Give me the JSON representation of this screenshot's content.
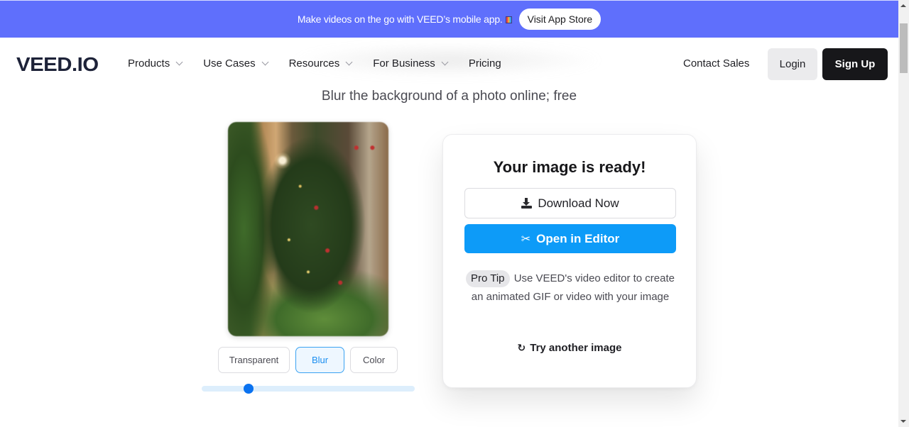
{
  "promo": {
    "text": "Make videos on the go with VEED’s mobile app.",
    "icon": "phone-app-icon",
    "cta_label": "Visit App Store",
    "bg_color": "#5f6ffc"
  },
  "nav": {
    "logo": "VEED.IO",
    "items": [
      {
        "label": "Products",
        "has_dropdown": true
      },
      {
        "label": "Use Cases",
        "has_dropdown": true
      },
      {
        "label": "Resources",
        "has_dropdown": true
      },
      {
        "label": "For Business",
        "has_dropdown": true
      },
      {
        "label": "Pricing",
        "has_dropdown": false
      }
    ],
    "contact_label": "Contact Sales",
    "login_label": "Login",
    "signup_label": "Sign Up"
  },
  "hero": {
    "subtitle": "Blur the background of a photo online; free"
  },
  "editor": {
    "preview_alt": "Blurred Christmas tree photo",
    "modes": [
      {
        "label": "Transparent",
        "active": false
      },
      {
        "label": "Blur",
        "active": true
      },
      {
        "label": "Color",
        "active": false
      }
    ],
    "blur_slider_value": 0.22
  },
  "result": {
    "title": "Your image is ready!",
    "download_label": "Download Now",
    "download_icon": "download-icon",
    "editor_label": "Open in Editor",
    "editor_icon": "scissors-icon",
    "tip_badge": "Pro Tip",
    "tip_text": "Use VEED's video editor to create an animated GIF or video with your image",
    "try_another_label": "Try another image",
    "try_another_icon": "refresh-icon",
    "accent_color": "#0d9bf8"
  }
}
